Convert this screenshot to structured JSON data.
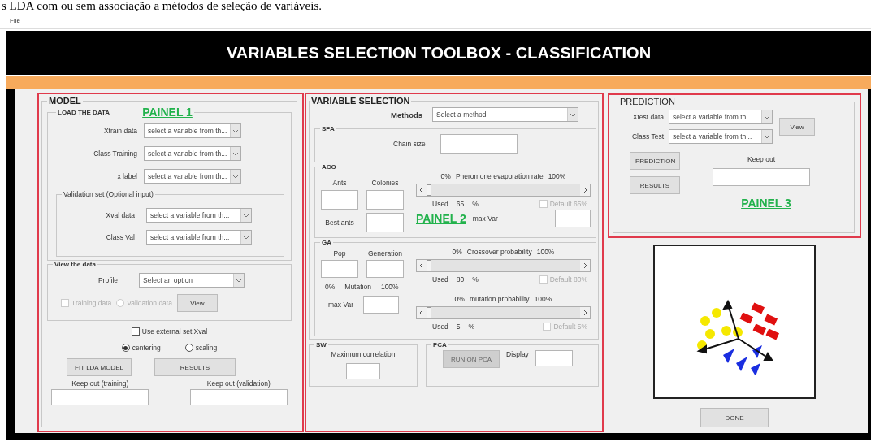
{
  "caption_fragment": "s LDA com ou sem associação a métodos de seleção de variáveis.",
  "menu": [
    "File"
  ],
  "title": "VARIABLES SELECTION TOOLBOX - CLASSIFICATION",
  "model": {
    "title": "MODEL",
    "annotation": "PAINEL 1",
    "load": {
      "title": "LOAD THE DATA",
      "fields": [
        {
          "label": "Xtrain data",
          "value": "select a variable from th..."
        },
        {
          "label": "Class Training",
          "value": "select a variable from th..."
        },
        {
          "label": "x label",
          "value": "select a variable from th..."
        }
      ]
    },
    "validation": {
      "title": "Validation set (Optional input)",
      "fields": [
        {
          "label": "Xval data",
          "value": "select a variable from th..."
        },
        {
          "label": "Class Val",
          "value": "select a variable from th..."
        }
      ]
    },
    "view": {
      "title": "View the data",
      "profile_label": "Profile",
      "profile_value": "Select an option",
      "options": [
        {
          "kind": "checkbox",
          "label": "Training data",
          "checked": false,
          "disabled": true
        },
        {
          "kind": "radio",
          "label": "Validation data",
          "selected": false,
          "disabled": true
        }
      ],
      "button": "View"
    },
    "external": {
      "label": "Use external set Xval",
      "checked": false
    },
    "preprocessing": [
      {
        "label": "centering",
        "selected": true
      },
      {
        "label": "scaling",
        "selected": false
      }
    ],
    "buttons": [
      "FIT LDA MODEL",
      "RESULTS"
    ],
    "keep_out": [
      "Keep out (training)",
      "Keep out (validation)"
    ]
  },
  "variable_selection": {
    "title": "VARIABLE SELECTION",
    "methods_label": "Methods",
    "methods_value": "Select a method",
    "annotation": "PAINEL 2",
    "spa": {
      "title": "SPA",
      "label": "Chain size"
    },
    "aco": {
      "title": "ACO",
      "ants": "Ants",
      "colonies": "Colonies",
      "best_ants": "Best ants",
      "max_var": "max Var",
      "slider": {
        "min": "0%",
        "label": "Pheromone evaporation rate",
        "max": "100%",
        "level": 0,
        "used": "Used",
        "value": "65",
        "unit": "%",
        "default": {
          "label": "Default 65%",
          "checked": false,
          "disabled": true
        }
      }
    },
    "ga": {
      "title": "GA",
      "pop": "Pop",
      "generation": "Generation",
      "mutation": [
        "0%",
        "Mutation",
        "100%"
      ],
      "max_var": "max Var",
      "sliders": [
        {
          "min": "0%",
          "label": "Crossover probability",
          "max": "100%",
          "level": 0,
          "used": "Used",
          "value": "80",
          "unit": "%",
          "default": {
            "label": "Default 80%",
            "checked": false,
            "disabled": true
          }
        },
        {
          "min": "0%",
          "label": "mutation probability",
          "max": "100%",
          "level": 0,
          "used": "Used",
          "value": "5",
          "unit": "%",
          "default": {
            "label": "Default 5%",
            "checked": false,
            "disabled": true
          }
        }
      ]
    },
    "sw": {
      "title": "SW",
      "label": "Maximum correlation"
    },
    "pca": {
      "title": "PCA",
      "button": "RUN ON PCA",
      "button_disabled": true,
      "display": "Display"
    }
  },
  "prediction": {
    "title": "PREDICTION",
    "annotation": "PAINEL 3",
    "fields": [
      {
        "label": "Xtest data",
        "value": "select a variable from th..."
      },
      {
        "label": "Class Test",
        "value": "select a variable from th..."
      }
    ],
    "view": "View",
    "buttons": [
      "PREDICTION",
      "RESULTS"
    ],
    "keep_out": "Keep out"
  },
  "done": "DONE"
}
